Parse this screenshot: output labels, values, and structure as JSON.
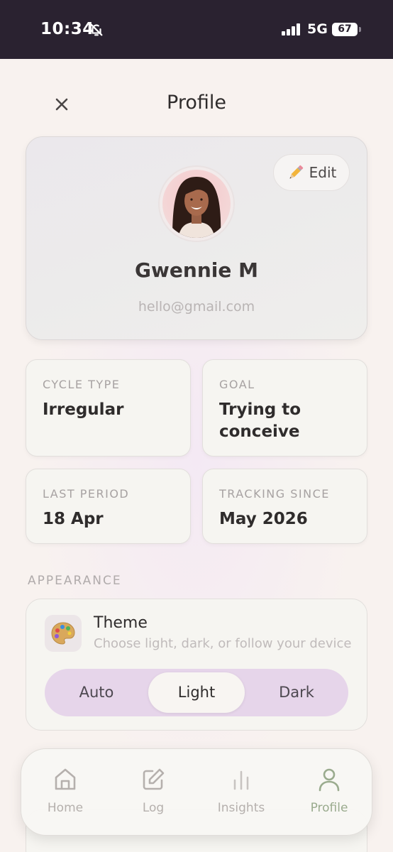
{
  "status_bar": {
    "time": "10:34",
    "network": "5G",
    "battery": "67"
  },
  "header": {
    "title": "Profile"
  },
  "profile": {
    "edit_icon": "pencil-icon",
    "edit_label": "Edit",
    "name": "Gwennie M",
    "email": "hello@gmail.com"
  },
  "info_cards": [
    {
      "label": "CYCLE TYPE",
      "value": "Irregular"
    },
    {
      "label": "GOAL",
      "value": "Trying to conceive"
    },
    {
      "label": "LAST PERIOD",
      "value": "18 Apr"
    },
    {
      "label": "TRACKING SINCE",
      "value": "May 2026"
    }
  ],
  "appearance": {
    "section_label": "APPEARANCE",
    "icon": "palette-icon",
    "title": "Theme",
    "subtitle": "Choose light, dark, or follow your device",
    "options": [
      "Auto",
      "Light",
      "Dark"
    ],
    "selected": "Light"
  },
  "tabbar": {
    "tabs": [
      {
        "label": "Home",
        "icon": "home-icon"
      },
      {
        "label": "Log",
        "icon": "edit-square-icon"
      },
      {
        "label": "Insights",
        "icon": "bar-chart-icon"
      },
      {
        "label": "Profile",
        "icon": "user-icon"
      }
    ],
    "active": "Profile"
  },
  "colors": {
    "status_bar_bg": "#2a2230",
    "segment_bg": "#e6d5ea",
    "active_tab": "#9aab8e",
    "card_bg": "#f6f5f1"
  }
}
